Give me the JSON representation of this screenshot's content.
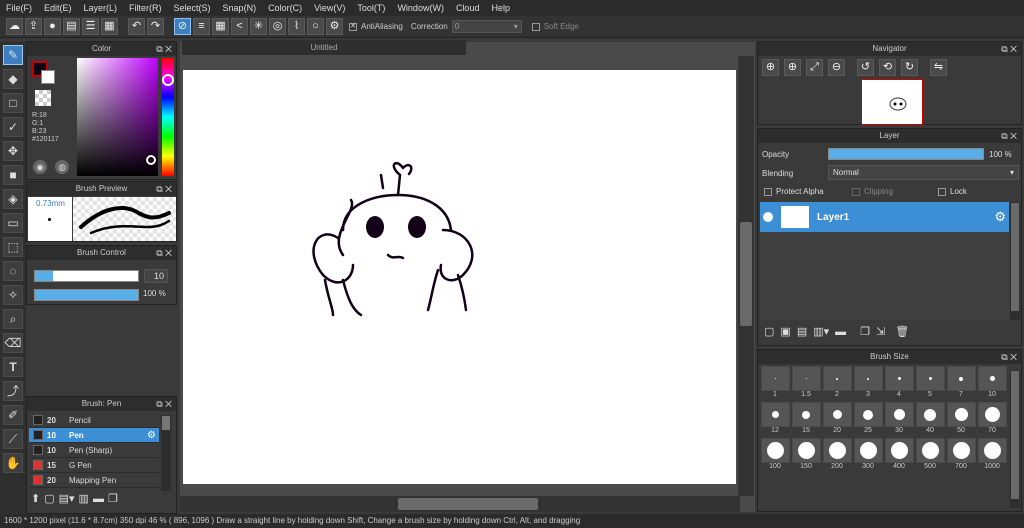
{
  "menu": [
    "File(F)",
    "Edit(E)",
    "Layer(L)",
    "Filter(R)",
    "Select(S)",
    "Snap(N)",
    "Color(C)",
    "View(V)",
    "Tool(T)",
    "Window(W)",
    "Cloud",
    "Help"
  ],
  "toolbar": {
    "antialiasing_label": "AntiAliasing",
    "correction_label": "Correction",
    "correction_value": "0",
    "soft_edge_label": "Soft Edge"
  },
  "document": {
    "tab_title": "Untitled"
  },
  "color_panel": {
    "title": "Color",
    "r": "R:18",
    "g": "G:1",
    "b": "B:23",
    "hex": "#120117",
    "foreground": "#120117",
    "accent": "#3d8fd5"
  },
  "brush_preview": {
    "title": "Brush Preview",
    "size": "0.73mm"
  },
  "brush_control": {
    "title": "Brush Control",
    "size_value": "10",
    "opacity_value": "100 %"
  },
  "brush_list": {
    "title": "Brush: Pen",
    "items": [
      {
        "size": "20",
        "name": "Pencil",
        "color": "#222222"
      },
      {
        "size": "10",
        "name": "Pen",
        "color": "#222222",
        "selected": true
      },
      {
        "size": "10",
        "name": "Pen (Sharp)",
        "color": "#222222"
      },
      {
        "size": "15",
        "name": "G Pen",
        "color": "#e03030"
      },
      {
        "size": "20",
        "name": "Mapping Pen",
        "color": "#e03030"
      }
    ]
  },
  "navigator": {
    "title": "Navigator"
  },
  "layer_panel": {
    "title": "Layer",
    "opacity_label": "Opacity",
    "opacity_value": "100 %",
    "blending_label": "Blending",
    "blending_value": "Normal",
    "protect_alpha": "Protect Alpha",
    "clipping": "Clipping",
    "lock": "Lock",
    "layers": [
      {
        "name": "Layer1"
      }
    ]
  },
  "brush_size": {
    "title": "Brush Size",
    "sizes": [
      "1",
      "1.5",
      "2",
      "3",
      "4",
      "5",
      "7",
      "10",
      "12",
      "15",
      "20",
      "25",
      "30",
      "40",
      "50",
      "70",
      "100",
      "150",
      "200",
      "300",
      "400",
      "500",
      "700",
      "1000"
    ]
  },
  "status": {
    "text": "1600 * 1200 pixel   (11.6 * 8.7cm)   350 dpi   46 %   ( 896, 1096 )   Draw a straight line by holding down Shift, Change a brush size by holding down Ctrl, Alt, and dragging"
  }
}
